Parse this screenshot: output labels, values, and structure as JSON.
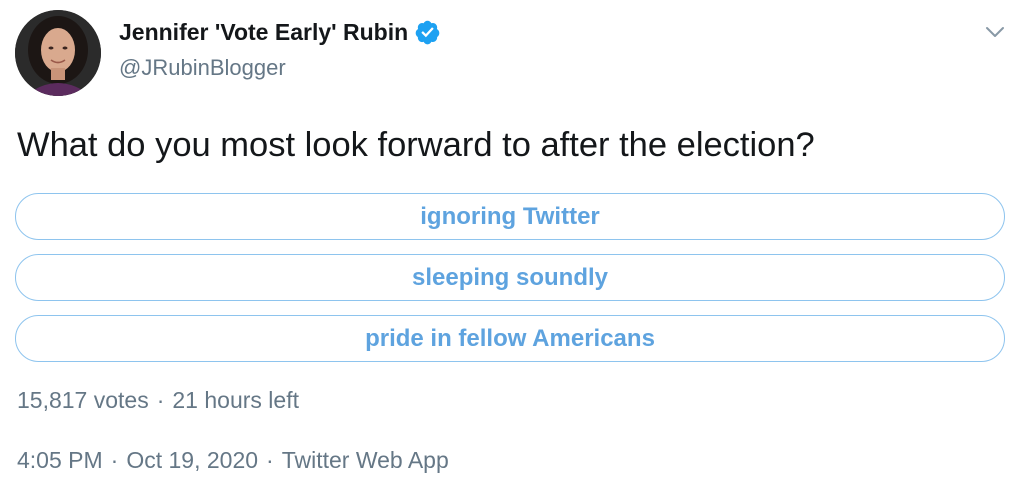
{
  "author": {
    "display_name": "Jennifer 'Vote Early' Rubin",
    "handle": "@JRubinBlogger",
    "verified_icon": "verified-badge-icon",
    "avatar": "profile-photo"
  },
  "menu_icon": "chevron-down-icon",
  "tweet": {
    "text": "What do you most look forward to after the election?"
  },
  "poll": {
    "options": [
      {
        "label": "ignoring Twitter"
      },
      {
        "label": "sleeping soundly"
      },
      {
        "label": "pride in fellow Americans"
      }
    ],
    "votes": "15,817 votes",
    "separator": "·",
    "time_left": "21 hours left"
  },
  "meta": {
    "time": "4:05 PM",
    "separator": "·",
    "date": "Oct 19, 2020",
    "separator2": "·",
    "source": "Twitter Web App"
  },
  "colors": {
    "accent": "#1da1f2",
    "poll_border": "#8ec4ee",
    "poll_text": "#5ea3df",
    "secondary_text": "#657786"
  }
}
